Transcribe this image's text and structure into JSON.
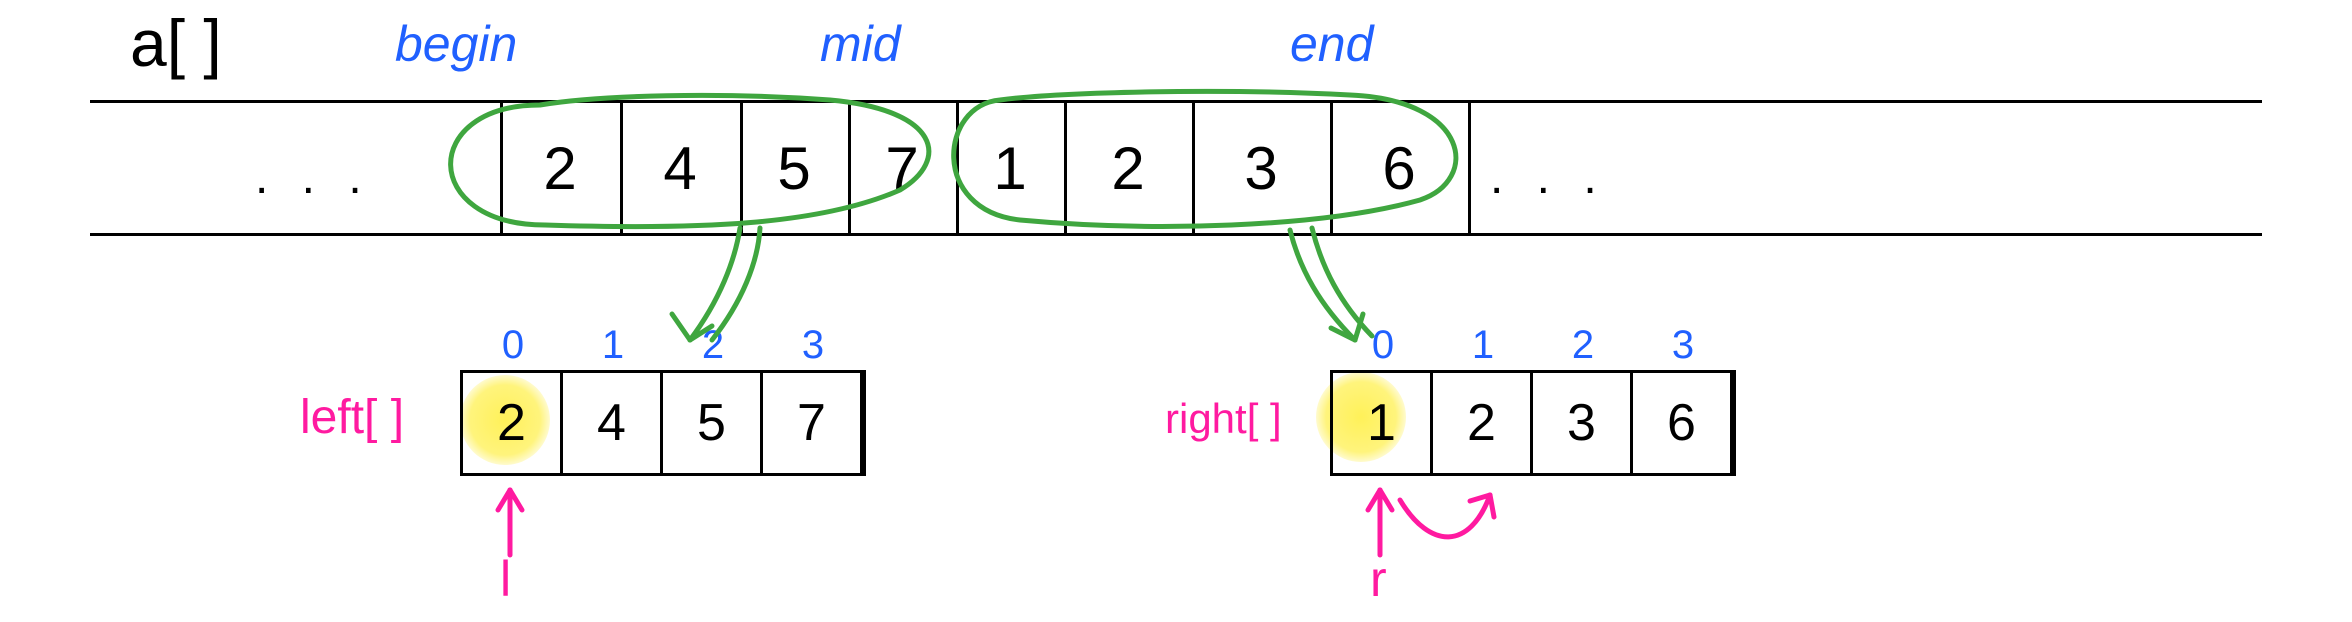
{
  "title": "a[ ]",
  "labels": {
    "begin": "begin",
    "mid": "mid",
    "end": "end",
    "left_array": "left[ ]",
    "right_array": "right[ ]",
    "l_ptr": "l",
    "r_ptr": "r",
    "ellipsis": ". . ."
  },
  "main_array": {
    "begin_index_label": "begin",
    "mid_index_label": "mid",
    "end_index_label": "end",
    "values": [
      "2",
      "4",
      "5",
      "7",
      "1",
      "2",
      "3",
      "6"
    ]
  },
  "left_array": {
    "indices": [
      "0",
      "1",
      "2",
      "3"
    ],
    "values": [
      "2",
      "4",
      "5",
      "7"
    ],
    "highlight_index": 0,
    "pointer_name": "l"
  },
  "right_array": {
    "indices": [
      "0",
      "1",
      "2",
      "3"
    ],
    "values": [
      "1",
      "2",
      "3",
      "6"
    ],
    "highlight_index": 0,
    "pointer_name": "r",
    "pointer_will_move_to": 1
  },
  "chart_data": {
    "type": "table",
    "description": "Merge-sort merge step illustration: a subarray of a[] from begin to end is split at mid into left[] and right[] copies; pointers l and r scan them.",
    "a_subarray": [
      2,
      4,
      5,
      7,
      1,
      2,
      3,
      6
    ],
    "left": [
      2,
      4,
      5,
      7
    ],
    "right": [
      1,
      2,
      3,
      6
    ],
    "pointers": {
      "l": 0,
      "r": 0,
      "r_next": 1
    },
    "index_labels": [
      "begin",
      "mid",
      "end"
    ]
  }
}
